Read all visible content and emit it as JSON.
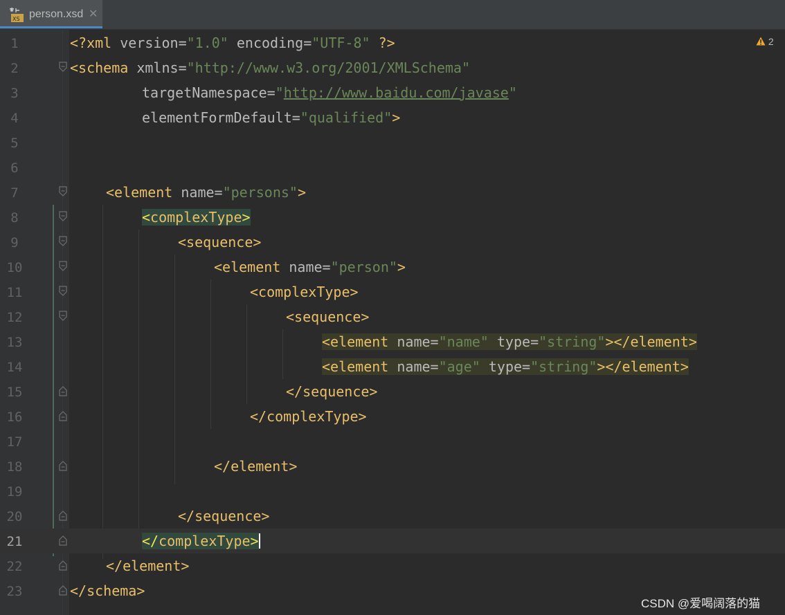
{
  "tab": {
    "title": "person.xsd",
    "close": "✕",
    "icon": "xsd-file-icon",
    "icon_label": "XS"
  },
  "warnings": {
    "count": "2",
    "icon": "warning-icon"
  },
  "watermark": "CSDN @爱喝阔落的猫",
  "colors": {
    "tag": "#e8bf6a",
    "attr": "#bababa",
    "value": "#6a8759",
    "background": "#2b2b2b",
    "gutter": "#313335"
  },
  "lines": [
    {
      "n": "1"
    },
    {
      "n": "2"
    },
    {
      "n": "3"
    },
    {
      "n": "4"
    },
    {
      "n": "5"
    },
    {
      "n": "6"
    },
    {
      "n": "7"
    },
    {
      "n": "8"
    },
    {
      "n": "9"
    },
    {
      "n": "10"
    },
    {
      "n": "11"
    },
    {
      "n": "12"
    },
    {
      "n": "13"
    },
    {
      "n": "14"
    },
    {
      "n": "15"
    },
    {
      "n": "16"
    },
    {
      "n": "17"
    },
    {
      "n": "18"
    },
    {
      "n": "19"
    },
    {
      "n": "20"
    },
    {
      "n": "21"
    },
    {
      "n": "22"
    },
    {
      "n": "23"
    }
  ],
  "code": {
    "l1": {
      "open": "<?xml",
      "a1": "version",
      "eq": "=",
      "v1": "\"1.0\"",
      "a2": "encoding",
      "v2": "\"UTF-8\"",
      "close": "?>"
    },
    "l2": {
      "open": "<schema",
      "a1": "xmlns",
      "eq": "=",
      "v1": "\"http://www.w3.org/2001/XMLSchema\""
    },
    "l3": {
      "a1": "targetNamespace",
      "eq": "=",
      "q": "\"",
      "v1": "http://www.baidu.com/javase"
    },
    "l4": {
      "a1": "elementFormDefault",
      "eq": "=",
      "v1": "\"qualified\"",
      "close": ">"
    },
    "l7": {
      "open": "<element",
      "a1": "name",
      "eq": "=",
      "v1": "\"persons\"",
      "close": ">"
    },
    "l8": {
      "bracket_open": "<",
      "tag": "complexType",
      "bracket_close": ">"
    },
    "l9": {
      "tag": "<sequence>"
    },
    "l10": {
      "open": "<element",
      "a1": "name",
      "eq": "=",
      "v1": "\"person\"",
      "close": ">"
    },
    "l11": {
      "tag": "<complexType>"
    },
    "l12": {
      "tag": "<sequence>"
    },
    "l13": {
      "open": "<element",
      "a1": "name",
      "eq": "=",
      "v1": "\"name\"",
      "a2": "type",
      "v2": "\"string\"",
      "close": "></element>"
    },
    "l14": {
      "open": "<element",
      "a1": "name",
      "eq": "=",
      "v1": "\"age\"",
      "a2": "type",
      "v2": "\"string\"",
      "close": "></element>"
    },
    "l15": {
      "tag": "</sequence>"
    },
    "l16": {
      "tag": "</complexType>"
    },
    "l18": {
      "tag": "</element>"
    },
    "l20": {
      "tag": "</sequence>"
    },
    "l21": {
      "bracket_open": "</",
      "tag": "complexType",
      "bracket_close": ">"
    },
    "l22": {
      "tag": "</element>"
    },
    "l23": {
      "tag": "</schema>"
    }
  }
}
